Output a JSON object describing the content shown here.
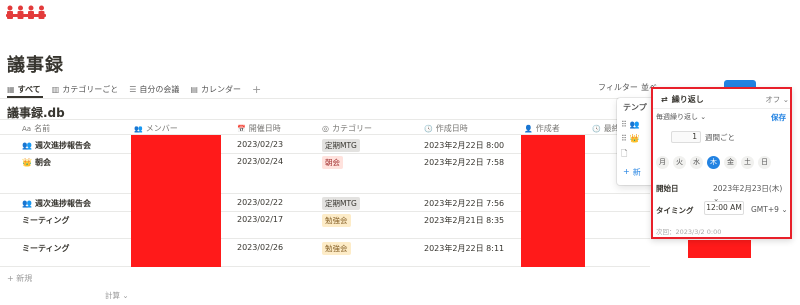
{
  "page": {
    "title": "議事録"
  },
  "views": [
    {
      "icon": "table-icon",
      "label": "すべて",
      "active": true
    },
    {
      "icon": "board-icon",
      "label": "カテゴリーごと",
      "active": false
    },
    {
      "icon": "list-icon",
      "label": "自分の会議",
      "active": false
    },
    {
      "icon": "calendar-icon",
      "label": "カレンダー",
      "active": false
    }
  ],
  "toolbar": {
    "filter": "フィルター",
    "sort": "並べ"
  },
  "database": {
    "title": "議事録.db"
  },
  "columns": [
    {
      "icon": "Aa",
      "label": "名前"
    },
    {
      "icon": "👥",
      "label": "メンバー"
    },
    {
      "icon": "📅",
      "label": "開催日時"
    },
    {
      "icon": "◎",
      "label": "カテゴリー"
    },
    {
      "icon": "🕓",
      "label": "作成日時"
    },
    {
      "icon": "👤",
      "label": "作成者"
    },
    {
      "icon": "🕓",
      "label": "最終更"
    }
  ],
  "rows": [
    {
      "icon": "👥",
      "name": "週次進捗報告会",
      "date": "2023/02/23",
      "category": "定期MTG",
      "tag_color": "gray",
      "created": "2023年2月22日 8:00"
    },
    {
      "icon": "👑",
      "name": "朝会",
      "date": "2023/02/24",
      "category": "朝会",
      "tag_color": "red",
      "created": "2023年2月22日 7:58"
    },
    {
      "icon": "👥",
      "name": "週次進捗報告会",
      "date": "2023/02/22",
      "category": "定期MTG",
      "tag_color": "gray",
      "created": "2023年2月22日 7:56"
    },
    {
      "icon": "",
      "name": "ミーティング",
      "date": "2023/02/17",
      "category": "勉強会",
      "tag_color": "yellow",
      "created": "2023年2月21日 8:35"
    },
    {
      "icon": "",
      "name": "ミーティング",
      "date": "2023/02/26",
      "category": "勉強会",
      "tag_color": "yellow",
      "created": "2023年2月22日 8:11"
    }
  ],
  "footer": {
    "new_row": "新規",
    "calc": "計算"
  },
  "template_panel": {
    "title": "テンプ",
    "new": "新"
  },
  "repeat_popup": {
    "title": "繰り返し",
    "status": "オフ",
    "frequency": "毎週繰り返し",
    "save": "保存",
    "interval": "1",
    "interval_unit": "週間ごと",
    "days": [
      "月",
      "火",
      "水",
      "木",
      "金",
      "土",
      "日"
    ],
    "selected_day": 3,
    "start_label": "開始日",
    "start_value": "2023年2月23日(木)",
    "timing_label": "タイミング",
    "time": "12:00 AM",
    "timezone": "GMT+9",
    "next": "次回：2023/3/2 0:00"
  },
  "colors": {
    "accent": "#2383e2",
    "redaction": "#ff1a1a",
    "highlight_border": "#e8202a",
    "logo": "#e33b3b"
  }
}
